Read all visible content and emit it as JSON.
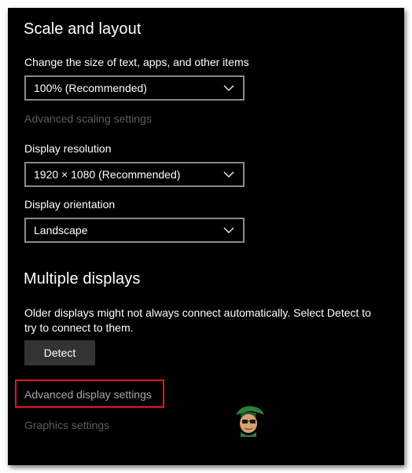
{
  "scale_layout": {
    "title": "Scale and layout",
    "size_label": "Change the size of text, apps, and other items",
    "size_value": "100% (Recommended)",
    "advanced_scaling_link": "Advanced scaling settings",
    "resolution_label": "Display resolution",
    "resolution_value": "1920 × 1080 (Recommended)",
    "orientation_label": "Display orientation",
    "orientation_value": "Landscape"
  },
  "multiple_displays": {
    "title": "Multiple displays",
    "description": "Older displays might not always connect automatically. Select Detect to try to connect to them.",
    "detect_button": "Detect",
    "advanced_display_link": "Advanced display settings",
    "graphics_link": "Graphics settings"
  },
  "icons": {
    "dropdown": "chevron-down-icon",
    "watermark": "appuals-mascot-icon"
  },
  "colors": {
    "background": "#000000",
    "text": "#ffffff",
    "disabled_text": "#5c5c5c",
    "link_text": "#a6a6a6",
    "dropdown_border": "#8a8a8a",
    "button_bg": "#333333",
    "highlight": "#e8141f"
  }
}
